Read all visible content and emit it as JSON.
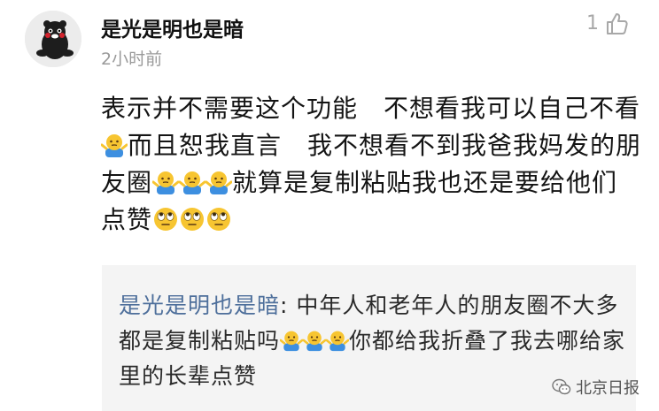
{
  "comment": {
    "username": "是光是明也是暗",
    "timestamp": "2小时前",
    "like_count": "1",
    "avatar_icon": "kumamon-avatar",
    "like_icon": "thumbs-up-icon",
    "text": {
      "part1": "表示并不需要这个功能　不想看我可以自己不看",
      "part2": "而且恕我直言　我不想看不到我爸我妈发的朋友圈",
      "part3": "就算是复制粘贴我也还是要给他们点赞"
    },
    "emojis": [
      "shrug-emoji",
      "eye-roll-emoji"
    ]
  },
  "reply": {
    "author": "是光是明也是暗",
    "separator": ": ",
    "part1": "中年人和老年人的朋友圈不大多都是复制粘贴吗",
    "part2": "你都给我折叠了我去哪给家里的长辈点赞"
  },
  "watermark": {
    "text": "北京日报",
    "icon": "wechat-icon"
  },
  "colors": {
    "reply_author": "#4e6f9b",
    "reply_bg": "#f4f4f4",
    "timestamp": "#9a9a9a"
  }
}
